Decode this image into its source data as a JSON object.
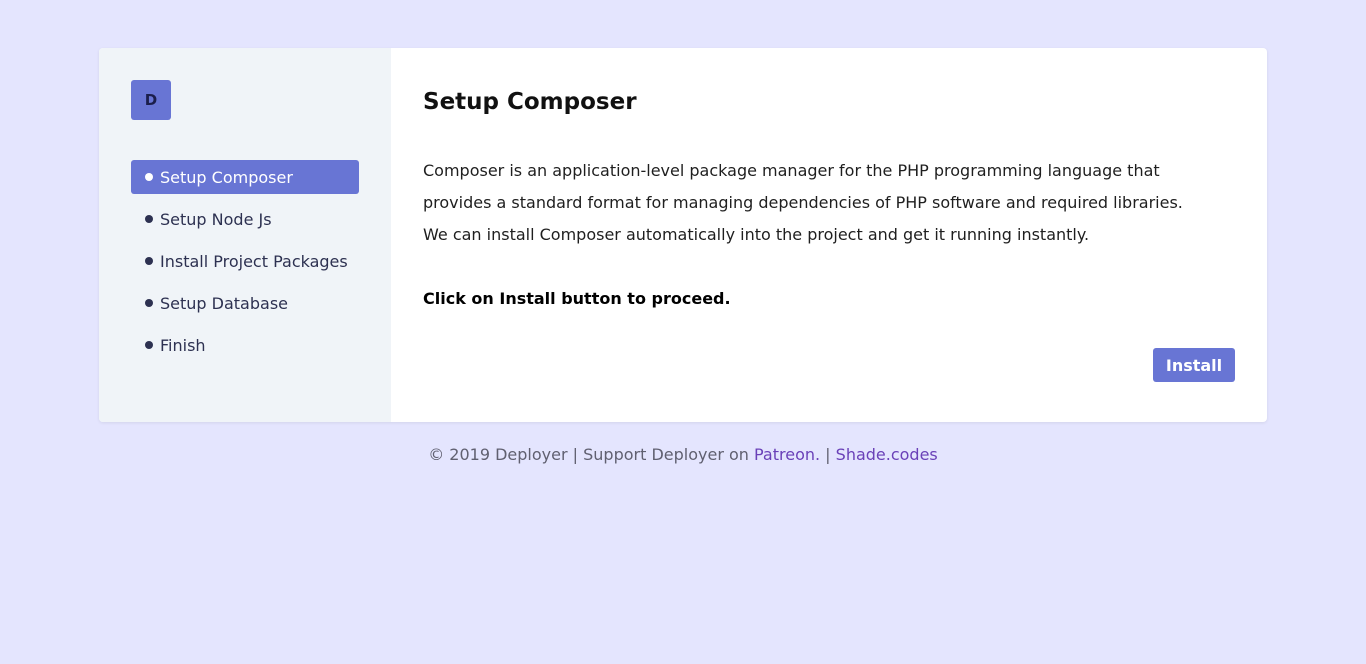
{
  "logo": {
    "letter": "D"
  },
  "sidebar": {
    "steps": [
      {
        "label": "Setup Composer",
        "active": true
      },
      {
        "label": "Setup Node Js",
        "active": false
      },
      {
        "label": "Install Project Packages",
        "active": false
      },
      {
        "label": "Setup Database",
        "active": false
      },
      {
        "label": "Finish",
        "active": false
      }
    ]
  },
  "main": {
    "title": "Setup Composer",
    "description": "Composer is an application-level package manager for the PHP programming language that provides a standard format for managing dependencies of PHP software and required libraries. We can install Composer automatically into the project and get it running instantly.",
    "proceed_text": "Click on Install button to proceed.",
    "install_label": "Install"
  },
  "footer": {
    "prefix": "© 2019 Deployer | Support Deployer on ",
    "patreon_link": "Patreon.",
    "separator": " | ",
    "shade_link": "Shade.codes"
  },
  "colors": {
    "background": "#e4e5fe",
    "accent": "#6875d4",
    "sidebar_bg": "#f0f4f8",
    "link": "#6a41b8"
  }
}
